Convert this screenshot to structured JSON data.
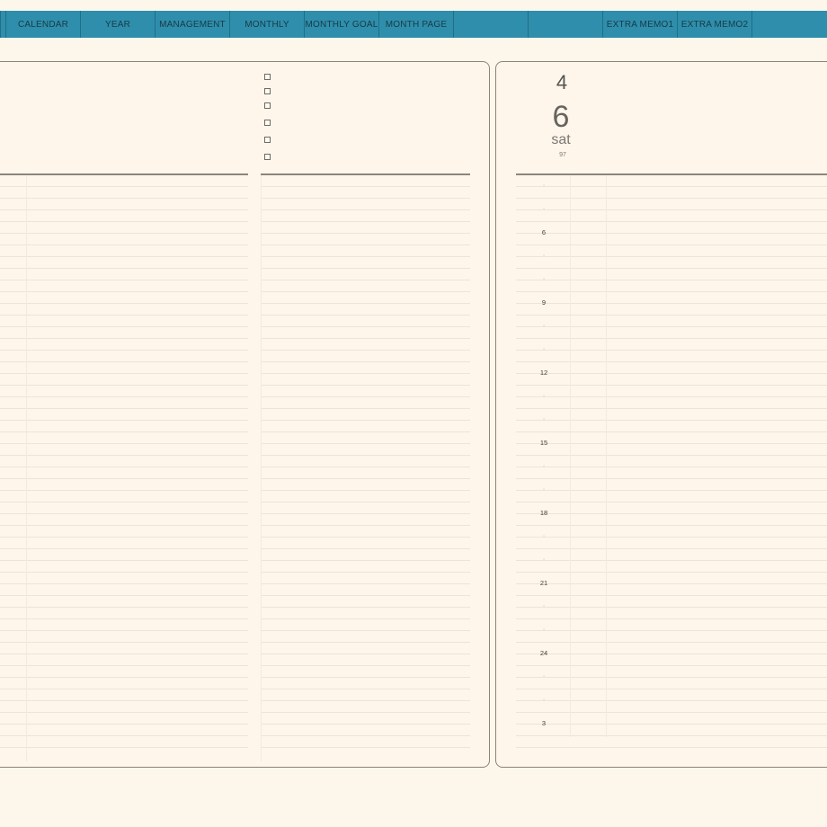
{
  "nav": {
    "tabs": [
      "CALENDAR",
      "YEAR",
      "MANAGEMENT",
      "MONTHLY",
      "MONTHLY GOAL",
      "MONTH PAGE",
      "",
      "",
      "EXTRA MEMO1",
      "EXTRA MEMO2"
    ]
  },
  "day": {
    "month": "4",
    "day": "6",
    "weekday": "sat",
    "extra": "97"
  },
  "schedule": {
    "hours": [
      "·",
      "·",
      "6",
      "·",
      "·",
      "9",
      "·",
      "·",
      "12",
      "·",
      "·",
      "15",
      "·",
      "·",
      "18",
      "·",
      "·",
      "21",
      "·",
      "·",
      "24",
      "·",
      "·",
      "3"
    ]
  },
  "checklist": {
    "count": 6
  },
  "colors": {
    "page_background": "#fdf6ea",
    "tab_bar": "#2f8eab",
    "tab_text": "#173b47",
    "panel_border": "#8b8279",
    "rule_line": "#ece4d6"
  }
}
